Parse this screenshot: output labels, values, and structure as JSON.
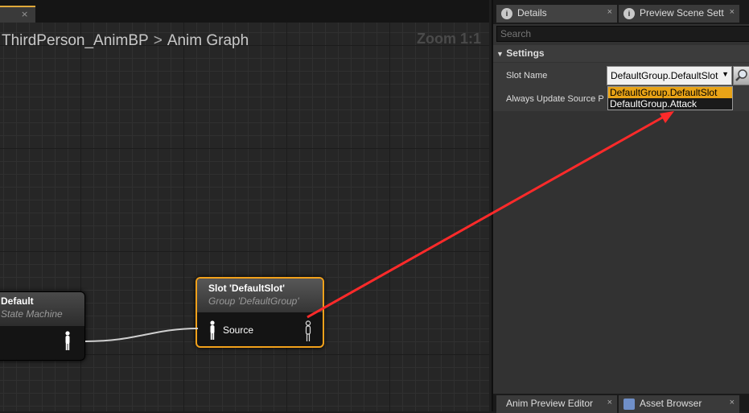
{
  "graph": {
    "breadcrumb": {
      "blueprint": "ThirdPerson_AnimBP",
      "separator": ">",
      "graph": "Anim Graph"
    },
    "zoom": "Zoom 1:1",
    "tab_close": "×"
  },
  "nodes": {
    "state_machine": {
      "title": "Default",
      "subtitle": "State Machine"
    },
    "slot": {
      "title": "Slot 'DefaultSlot'",
      "subtitle": "Group 'DefaultGroup'",
      "input_pin": "Source"
    }
  },
  "details": {
    "tabs": [
      {
        "label": "Details",
        "close": "×"
      },
      {
        "label": "Preview Scene Sett",
        "close": "×"
      }
    ],
    "search": {
      "placeholder": "Search"
    },
    "section": "Settings",
    "rows": [
      {
        "label": "Slot Name"
      },
      {
        "label": "Always Update Source P"
      }
    ],
    "slot_combo": {
      "value": "DefaultGroup.DefaultSlot",
      "options": [
        "DefaultGroup.DefaultSlot",
        "DefaultGroup.Attack"
      ],
      "selected_index": 0
    },
    "bottom_tabs": [
      {
        "label": "Anim Preview Editor",
        "close": "×"
      },
      {
        "label": "Asset Browser",
        "close": "×"
      }
    ]
  },
  "colors": {
    "selection_outline": "#f2a11b",
    "dropdown_highlight": "#e8a317",
    "annotation_arrow": "#ff2a2a",
    "wire": "#cfcfcf"
  }
}
